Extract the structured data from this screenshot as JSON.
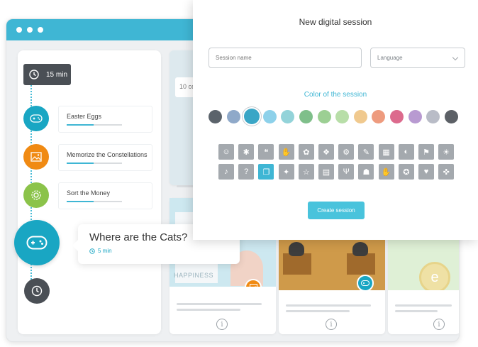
{
  "timeline": {
    "duration": "15 min",
    "steps": [
      {
        "label": "Easter Eggs",
        "icon": "gamepad-icon",
        "color": "#19a6c3"
      },
      {
        "label": "Memorize the Constellations",
        "icon": "picture-icon",
        "color": "#f08a13"
      },
      {
        "label": "Sort the Money",
        "icon": "gear-icon",
        "color": "#8bc34a"
      }
    ],
    "active_step": {
      "title": "Where are the Cats?",
      "time": "5 min",
      "icon": "gamepad-icon"
    }
  },
  "background": {
    "card_snippet": "10 cé",
    "happiness_label": "HAPPINESS",
    "letter_badge": "e"
  },
  "modal": {
    "title": "New digital session",
    "session_name_placeholder": "Session name",
    "language_placeholder": "Language",
    "color_label": "Color of the session",
    "colors": [
      "#5b636b",
      "#8fa9c9",
      "#3aa6c6",
      "#8dd1ea",
      "#93d3d9",
      "#7fbf8a",
      "#9ccf93",
      "#b8dea8",
      "#f0c98e",
      "#ee9b7e",
      "#dc6a8d",
      "#b89ad1",
      "#b9bcc7",
      "#5c6066"
    ],
    "selected_color_index": 2,
    "icons": [
      "person-icon",
      "brain-thought-icon",
      "chat-icon",
      "wave-hand-icon",
      "brain-icon",
      "puzzle-brain-icon",
      "mind-gear-icon",
      "head-tools-icon",
      "building-icon",
      "globe-head-icon",
      "flag-icon",
      "head-idea-icon",
      "hearing-icon",
      "brain-question-icon",
      "book-chat-icon",
      "lightbulb-icon",
      "runner-icon",
      "stairs-icon",
      "cutlery-icon",
      "group-icon",
      "hand-icon",
      "star-head-icon",
      "head-heart-icon",
      "compass-icon"
    ],
    "icon_glyphs": [
      "☺",
      "✱",
      "❝",
      "✋",
      "✿",
      "❖",
      "⚙",
      "✎",
      "▦",
      "◐",
      "⚑",
      "☀",
      "♪",
      "?",
      "❐",
      "✦",
      "☆",
      "▤",
      "Ψ",
      "☗",
      "✋",
      "✪",
      "♥",
      "✜"
    ],
    "selected_icon_index": 14,
    "create_button": "Create session"
  }
}
